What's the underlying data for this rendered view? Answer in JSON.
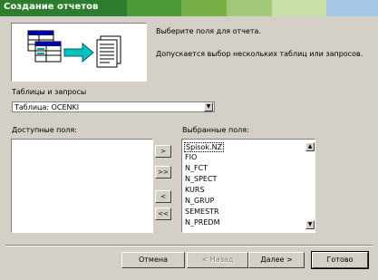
{
  "window": {
    "title": "Создание отчетов"
  },
  "intro": {
    "line1": "Выберите поля для отчета.",
    "line2": "Допускается выбор нескольких таблиц или запросов."
  },
  "source": {
    "label": "Таблицы и запросы",
    "selected": "Таблица: OCENKI"
  },
  "available": {
    "label": "Доступные поля:",
    "items": []
  },
  "chosen": {
    "label": "Выбранные поля:",
    "items": [
      "Spisok.NZ",
      "FIO",
      "N_FCT",
      "N_SPECT",
      "KURS",
      "N_GRUP",
      "SEMESTR",
      "N_PREDM"
    ]
  },
  "move_buttons": {
    "add": ">",
    "add_all": ">>",
    "remove": "<",
    "remove_all": "<<"
  },
  "buttons": {
    "cancel": "Отмена",
    "back": "< Назад",
    "next": "Далее >",
    "finish": "Готово"
  }
}
